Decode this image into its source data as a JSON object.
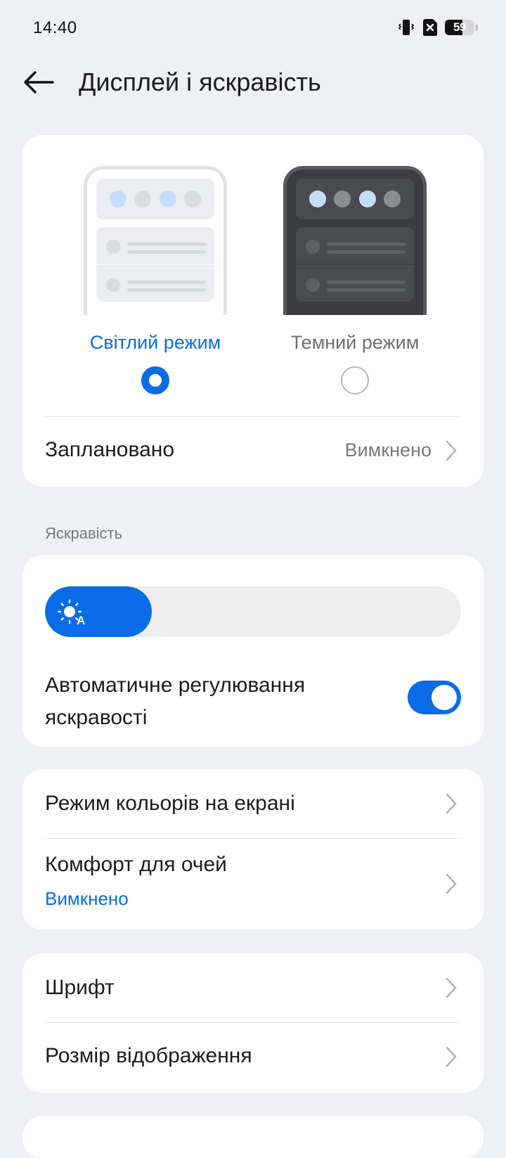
{
  "status_bar": {
    "time": "14:40",
    "battery_level": "59",
    "icons": [
      "vibrate-icon",
      "no-sim-icon",
      "battery-icon"
    ]
  },
  "header": {
    "title": "Дисплей і яскравість",
    "back_icon": "arrow-left-icon"
  },
  "display_mode": {
    "light_label": "Світлий режим",
    "dark_label": "Темний режим",
    "selected": "light",
    "scheduled_label": "Заплановано",
    "scheduled_value": "Вимкнено"
  },
  "brightness": {
    "section_title": "Яскравість",
    "level_percent": 25,
    "auto_label": "Автоматичне регулювання яскравості",
    "auto_enabled": true
  },
  "color": {
    "screen_color_mode_label": "Режим кольорів на екрані",
    "eye_comfort_label": "Комфорт для очей",
    "eye_comfort_value": "Вимкнено"
  },
  "fonts": {
    "font_label": "Шрифт",
    "display_size_label": "Розмір відображення"
  },
  "colors": {
    "accent": "#0a6ce6",
    "background": "#eef0f3",
    "card": "#ffffff",
    "secondary_text": "#7a7a7e"
  }
}
